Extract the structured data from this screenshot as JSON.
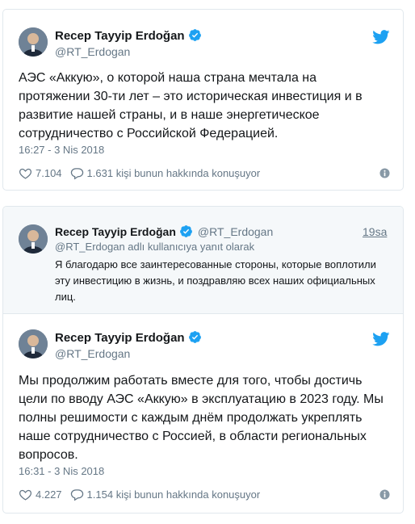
{
  "tweet1": {
    "author_name": "Recep Tayyip Erdoğan",
    "author_handle": "@RT_Erdogan",
    "text": "АЭС «Аккую», о которой наша страна мечтала на протяжении 30-ти лет – это историческая инвестиция и в развитие нашей страны, и в наше энергетическое сотрудничество с Российской Федерацией.",
    "timestamp": "16:27 - 3 Nis 2018",
    "likes": "7.104",
    "replies_text": "1.631 kişi bunun hakkında konuşuyor"
  },
  "reply_tweet": {
    "author_name": "Recep Tayyip Erdoğan",
    "author_handle": "@RT_Erdogan",
    "time": "19sa",
    "reply_context": "@RT_Erdogan adlı kullanıcıya yanıt olarak",
    "text": "Я благодарю все заинтересованные стороны, которые воплотили эту инвестицию в жизнь, и поздравляю всех наших официальных лиц."
  },
  "tweet2": {
    "author_name": "Recep Tayyip Erdoğan",
    "author_handle": "@RT_Erdogan",
    "text": "Мы продолжим работать вместе для того, чтобы достичь цели по вводу АЭС «Аккую» в эксплуатацию в 2023 году. Мы полны решимости с каждым днём продолжать укреплять наше сотрудничество с Россией, в области региональных вопросов.",
    "timestamp": "16:31 - 3 Nis 2018",
    "likes": "4.227",
    "replies_text": "1.154 kişi bunun hakkında konuşuyor"
  },
  "colors": {
    "twitter_blue": "#1da1f2",
    "secondary_text": "#657786",
    "card_border": "#e1e8ed",
    "reply_background": "#f5f8fa"
  },
  "icons": {
    "verified": "verified-badge-icon",
    "twitter": "twitter-bird-icon",
    "like": "heart-icon",
    "reply": "speech-bubble-icon",
    "info": "info-icon"
  }
}
